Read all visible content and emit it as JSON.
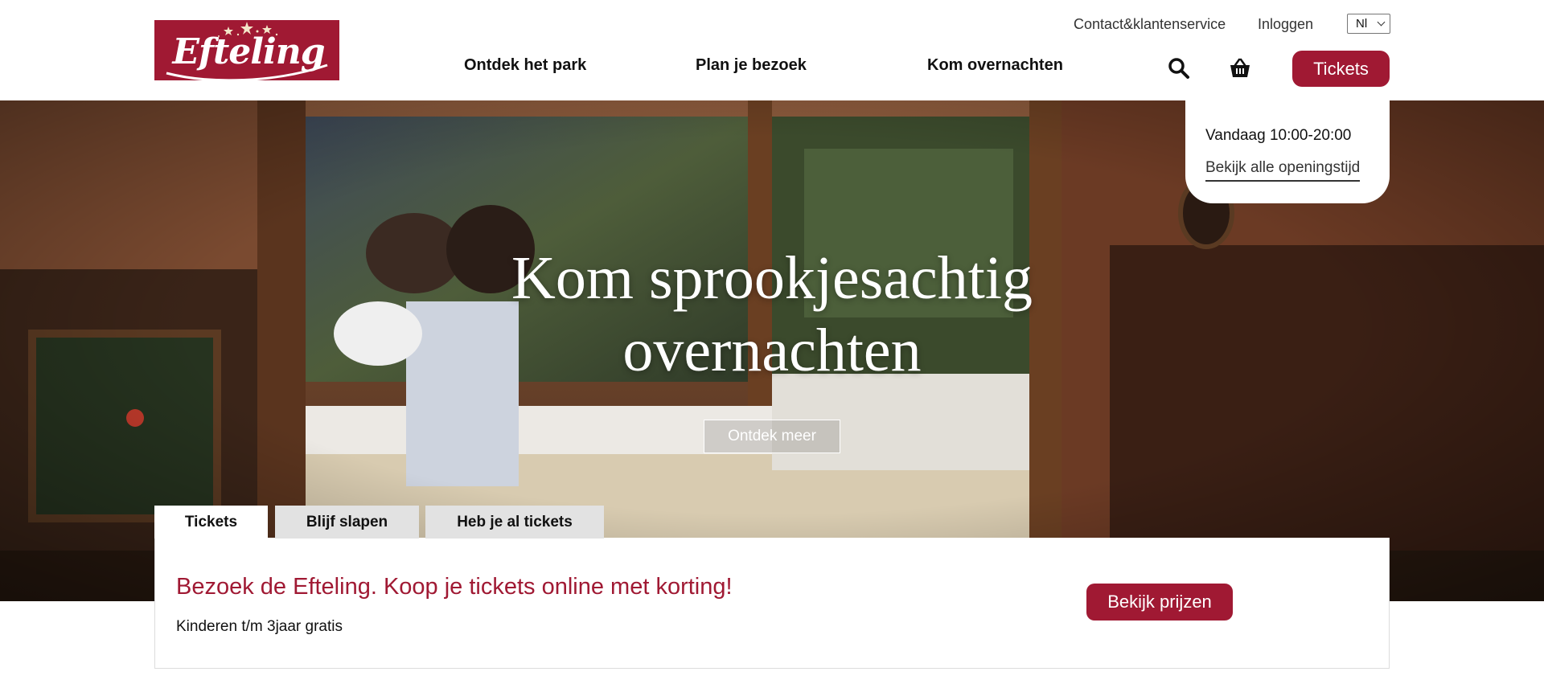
{
  "brand": {
    "logo_text": "Efteling",
    "primary_color": "#a01933"
  },
  "header": {
    "utility": {
      "contact": "Contact&klantenservice",
      "login": "Inloggen",
      "language": "Nl"
    },
    "nav": [
      "Ontdek het park",
      "Plan je bezoek",
      "Kom overnachten"
    ],
    "icons": [
      "search-icon",
      "basket-icon"
    ],
    "tickets_label": "Tickets"
  },
  "hours": {
    "today": "Vandaag 10:00-20:00",
    "link": "Bekijk alle openingstijd"
  },
  "hero": {
    "title_line1": "Kom sprookjesachtig",
    "title_line2": "overnachten",
    "cta": "Ontdek meer"
  },
  "tabs": [
    "Tickets",
    "Blijf slapen",
    "Heb je al tickets"
  ],
  "panel": {
    "title": "Bezoek de Efteling. Koop je tickets online met korting!",
    "subtitle": "Kinderen t/m 3jaar gratis",
    "button": "Bekijk prijzen"
  }
}
